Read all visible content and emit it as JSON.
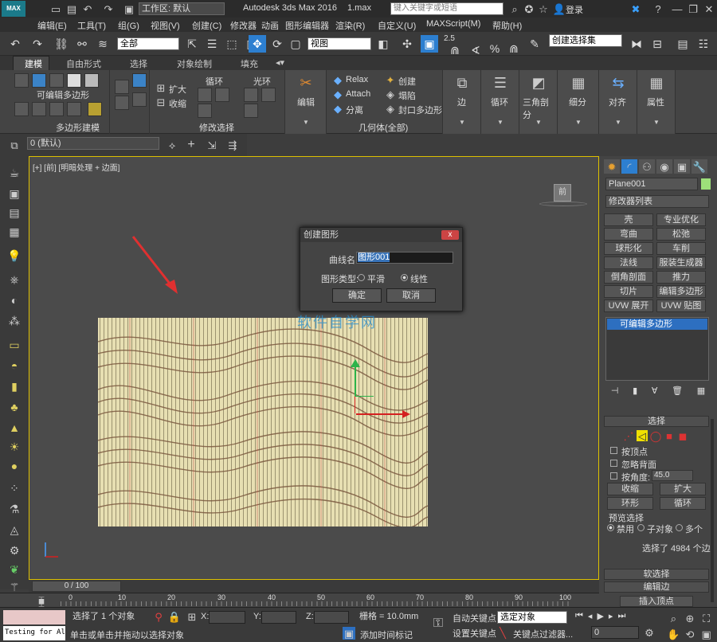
{
  "titlebar": {
    "app_logo": "MAX",
    "workspace": "工作区: 默认",
    "app_title": "Autodesk 3ds Max 2016",
    "file_name": "1.max",
    "search_placeholder": "键入关键字或短语",
    "login_label": "登录"
  },
  "menubar": {
    "items": [
      "编辑(E)",
      "工具(T)",
      "组(G)",
      "视图(V)",
      "创建(C)",
      "修改器",
      "动画",
      "图形编辑器",
      "渲染(R)",
      "自定义(U)",
      "MAXScript(M)",
      "帮助(H)"
    ]
  },
  "toolbar": {
    "filter_value": "全部",
    "view_value": "视图",
    "spinner_value": "2.5",
    "selection_set_placeholder": "创建选择集"
  },
  "ribbon_tabs": [
    "建模",
    "自由形式",
    "选择",
    "对象绘制",
    "填充"
  ],
  "ribbon": {
    "poly_label": "可编辑多边形",
    "polymodel_label": "多边形建模",
    "expand_label": "扩大",
    "shrink_label": "收缩",
    "loop_label": "循环",
    "ring_label": "光环",
    "modify_selection_label": "修改选择",
    "edit_label": "编辑",
    "relax_label": "Relax",
    "create_label": "创建",
    "attach_label": "Attach",
    "collapse_label": "塌陷",
    "detach_label": "分离",
    "cap_label": "封口多边形",
    "geometry_label": "几何体(全部)",
    "edge_label": "边",
    "loop2_label": "循环",
    "tri_label": "三角剖分",
    "subdiv_label": "细分",
    "align_label": "对齐",
    "props_label": "属性"
  },
  "layerbar": {
    "layer_value": "0 (默认)"
  },
  "viewport": {
    "label": "[+] [前] [明暗处理 + 边面]",
    "viewcube_label": "前",
    "watermark": "软件自学网"
  },
  "dialog": {
    "title": "创建图形",
    "close_label": "x",
    "curve_name_label": "曲线名:",
    "curve_name_value": "图形001",
    "shape_type_label": "图形类型:",
    "option_smooth": "平滑",
    "option_linear": "线性",
    "ok_label": "确定",
    "cancel_label": "取消"
  },
  "right_panel": {
    "object_name": "Plane001",
    "modifier_list": "修改器列表",
    "modifier_buttons": [
      "壳",
      "专业优化",
      "弯曲",
      "松弛",
      "球形化",
      "车削",
      "法线",
      "服装生成器",
      "倒角剖面",
      "推力",
      "切片",
      "编辑多边形",
      "UVW 展开",
      "UVW 贴图"
    ],
    "stack_item": "可编辑多边形",
    "selection_header": "选择",
    "by_vertex": "按顶点",
    "ignore_backfacing": "忽略背面",
    "by_angle": "按角度:",
    "angle_value": "45.0",
    "shrink": "收缩",
    "grow": "扩大",
    "ring": "环形",
    "loop": "循环",
    "preview_selection": "预览选择",
    "preview_off": "禁用",
    "preview_subobject": "子对象",
    "preview_multi": "多个",
    "selection_count": "选择了 4984 个边",
    "soft_selection": "软选择",
    "edit_edges": "编辑边",
    "insert_vertex": "插入顶点"
  },
  "timeline": {
    "frame_label": "0 / 100",
    "ticks": [
      "0",
      "10",
      "20",
      "30",
      "40",
      "50",
      "60",
      "70",
      "80",
      "90",
      "100"
    ]
  },
  "status": {
    "script_label": "Testing for All",
    "selected_objects": "选择了 1 个对象",
    "prompt": "单击或单击并拖动以选择对象",
    "x_label": "X:",
    "y_label": "Y:",
    "z_label": "Z:",
    "grid": "栅格 = 10.0mm",
    "add_time_tag": "添加时间标记",
    "auto_key": "自动关键点",
    "set_key": "设置关键点",
    "selected_object_dropdown": "选定对象",
    "key_filters": "关键点过滤器...",
    "frame_value": "0"
  }
}
